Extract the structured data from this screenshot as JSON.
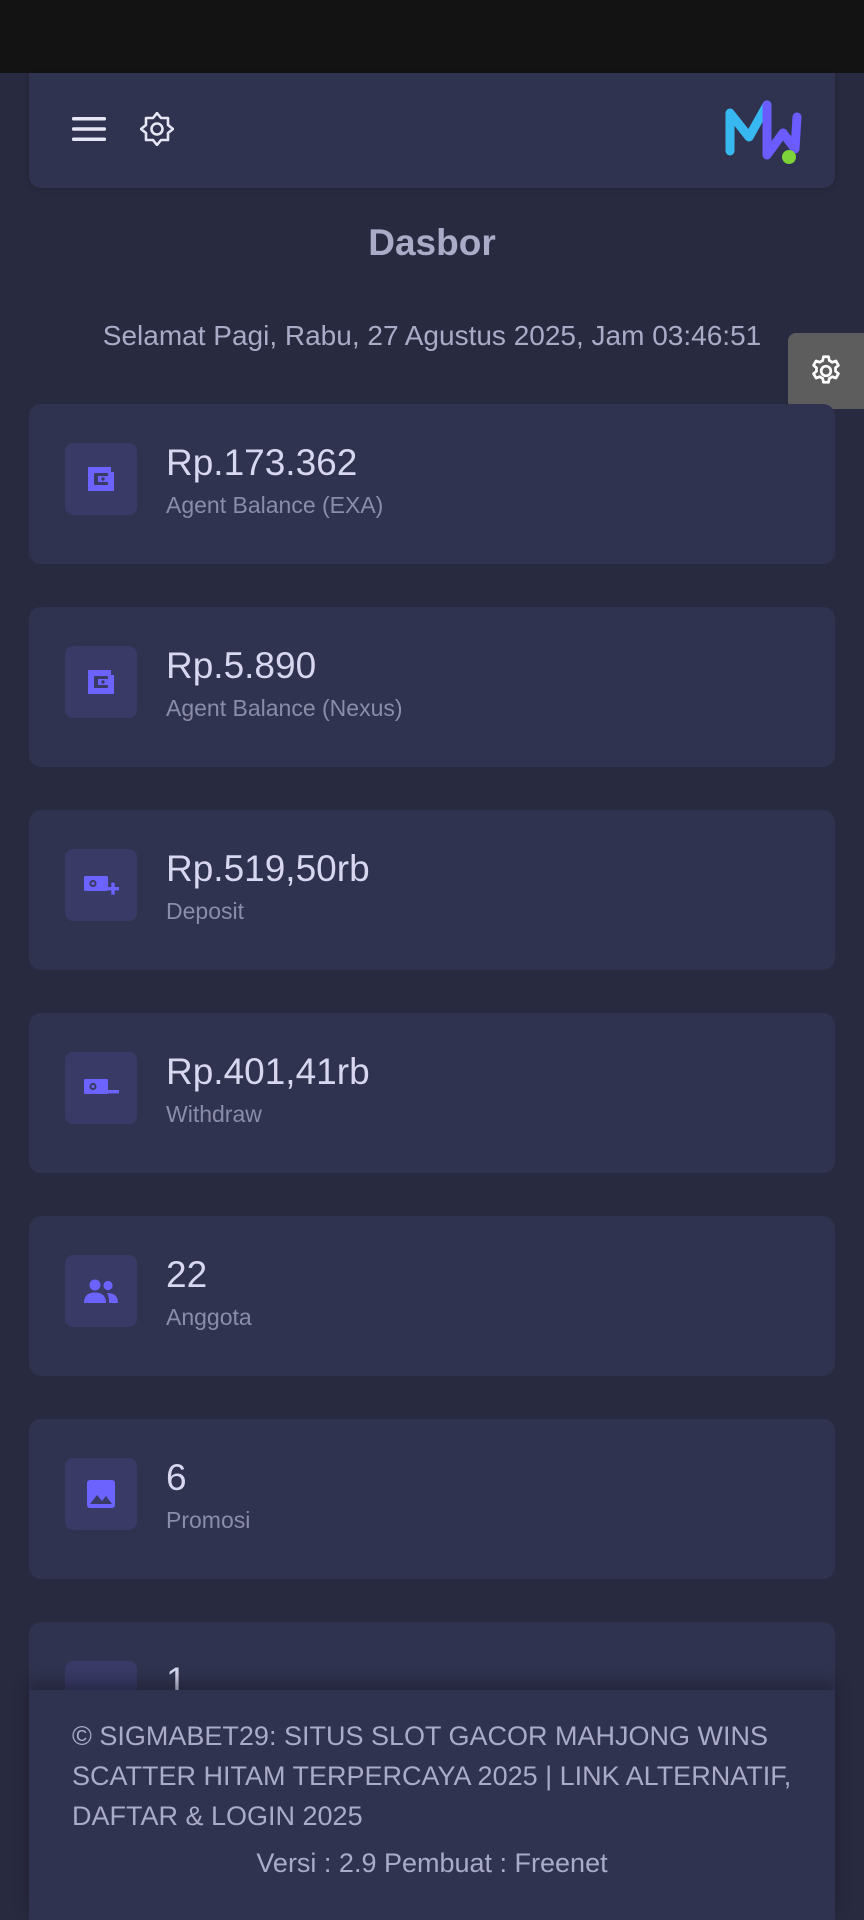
{
  "header": {
    "menu_icon": "menu-icon",
    "theme_icon": "brightness-icon",
    "logo": "brand-logo"
  },
  "page": {
    "title": "Dasbor",
    "greeting": "Selamat Pagi, Rabu, 27 Agustus 2025, Jam 03:46:51"
  },
  "settings_fab": {
    "icon": "gear-icon"
  },
  "stats": [
    {
      "value": "Rp.173.362",
      "label": "Agent Balance (EXA)",
      "icon": "wallet-icon"
    },
    {
      "value": "Rp.5.890",
      "label": "Agent Balance (Nexus)",
      "icon": "wallet-icon"
    },
    {
      "value": "Rp.519,50rb",
      "label": "Deposit",
      "icon": "money-plus-icon"
    },
    {
      "value": "Rp.401,41rb",
      "label": "Withdraw",
      "icon": "money-minus-icon"
    },
    {
      "value": "22",
      "label": "Anggota",
      "icon": "people-icon"
    },
    {
      "value": "6",
      "label": "Promosi",
      "icon": "image-icon"
    },
    {
      "value": "1",
      "label": "",
      "icon": "partial-icon"
    }
  ],
  "footer": {
    "copyright": "© SIGMABET29: SITUS SLOT GACOR MAHJONG WINS SCATTER HITAM TERPERCAYA 2025 | LINK ALTERNATIF, DAFTAR & LOGIN 2025",
    "version": "Versi : 2.9 Pembuat : Freenet"
  },
  "colors": {
    "background": "#282a3f",
    "card": "#30334f",
    "accent": "#6c63ff",
    "icon_box": "#393a66",
    "logo_cyan": "#38b8f0",
    "logo_violet": "#6a5cff",
    "logo_green": "#7cd43a"
  }
}
